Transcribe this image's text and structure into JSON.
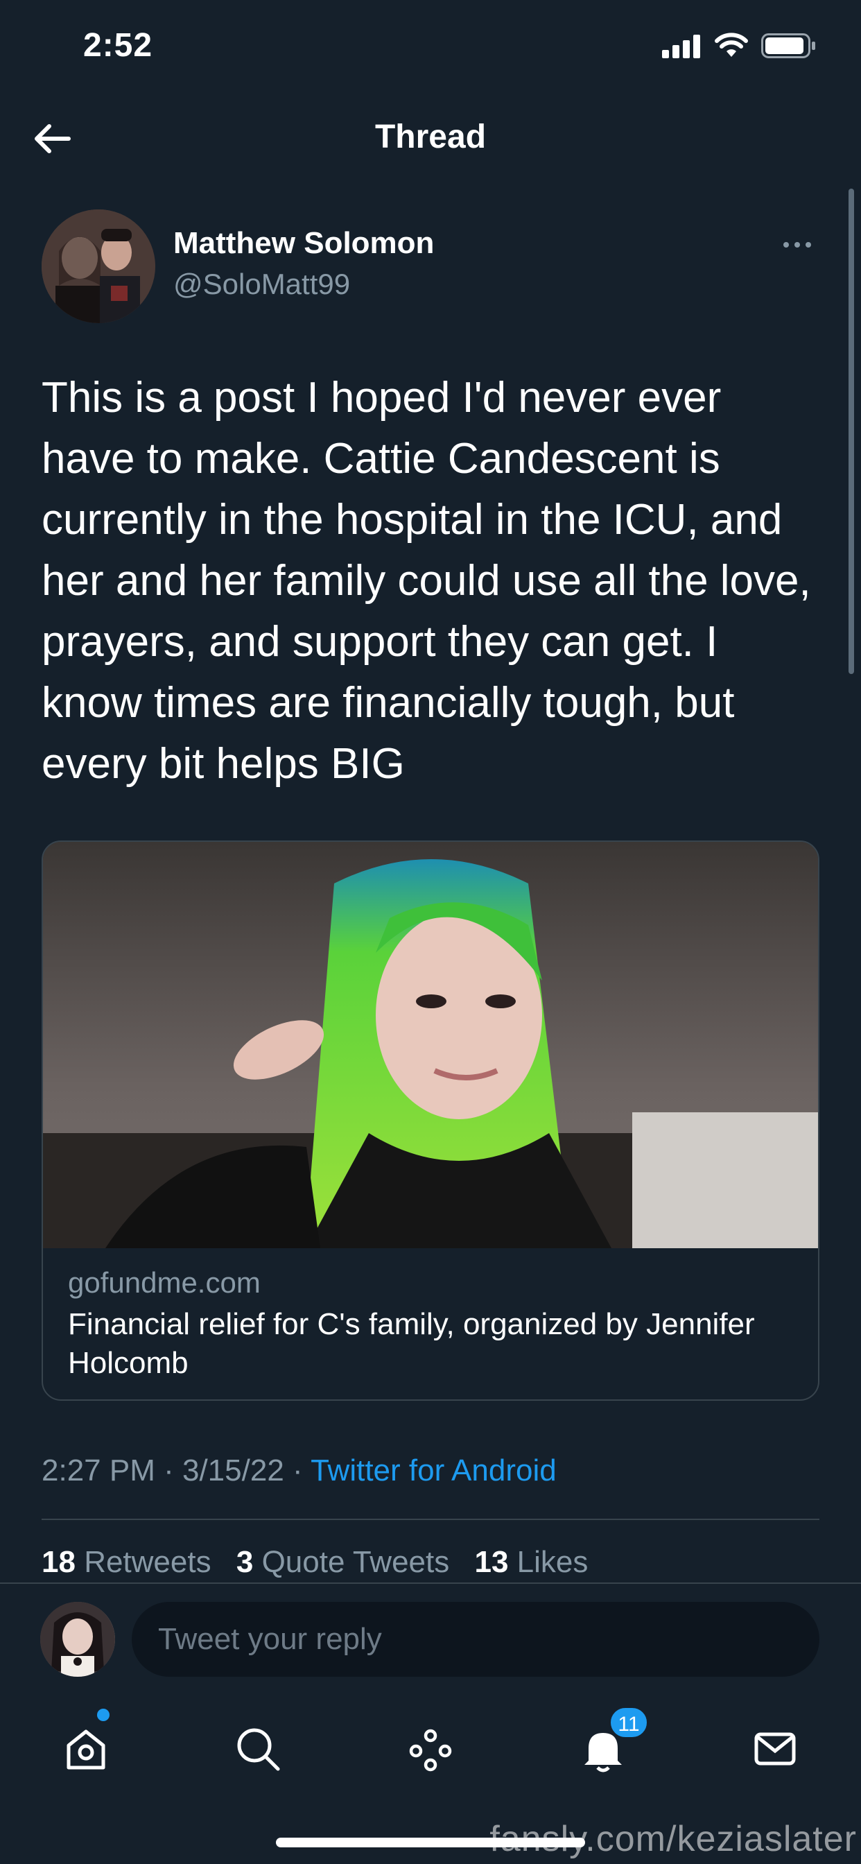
{
  "status_bar": {
    "time": "2:52",
    "icons": [
      "signal-icon",
      "wifi-icon",
      "battery-icon"
    ]
  },
  "header": {
    "title": "Thread",
    "back_icon": "arrow-left-icon"
  },
  "tweet": {
    "author": {
      "name": "Matthew Solomon",
      "handle": "@SoloMatt99"
    },
    "more_icon": "more-horizontal-icon",
    "text": "This is a post I hoped I'd never ever have to make. Cattie Candescent is currently in the hospital in the ICU, and her and her family could use all the love, prayers, and support they can get. I know times are financially tough, but every bit helps BIG",
    "card": {
      "domain": "gofundme.com",
      "title": "Financial relief for C's family, organized by Jennifer Holcomb"
    },
    "meta": {
      "time": "2:27 PM",
      "date": "3/15/22",
      "separator": " · ",
      "source": "Twitter for Android"
    },
    "stats": {
      "retweets_count": "18",
      "retweets_label": "Retweets",
      "quotes_count": "3",
      "quotes_label": "Quote Tweets",
      "likes_count": "13",
      "likes_label": "Likes"
    }
  },
  "reply": {
    "placeholder": "Tweet your reply"
  },
  "tab_bar": {
    "tabs": [
      "home-icon",
      "search-icon",
      "spaces-icon",
      "notifications-icon",
      "messages-icon"
    ],
    "notifications_badge": "11"
  },
  "watermark": "fansly.com/keziaslater",
  "colors": {
    "background": "#15202b",
    "accent": "#1d9bf0",
    "secondary_text": "#8899a6",
    "border": "#38444d"
  }
}
